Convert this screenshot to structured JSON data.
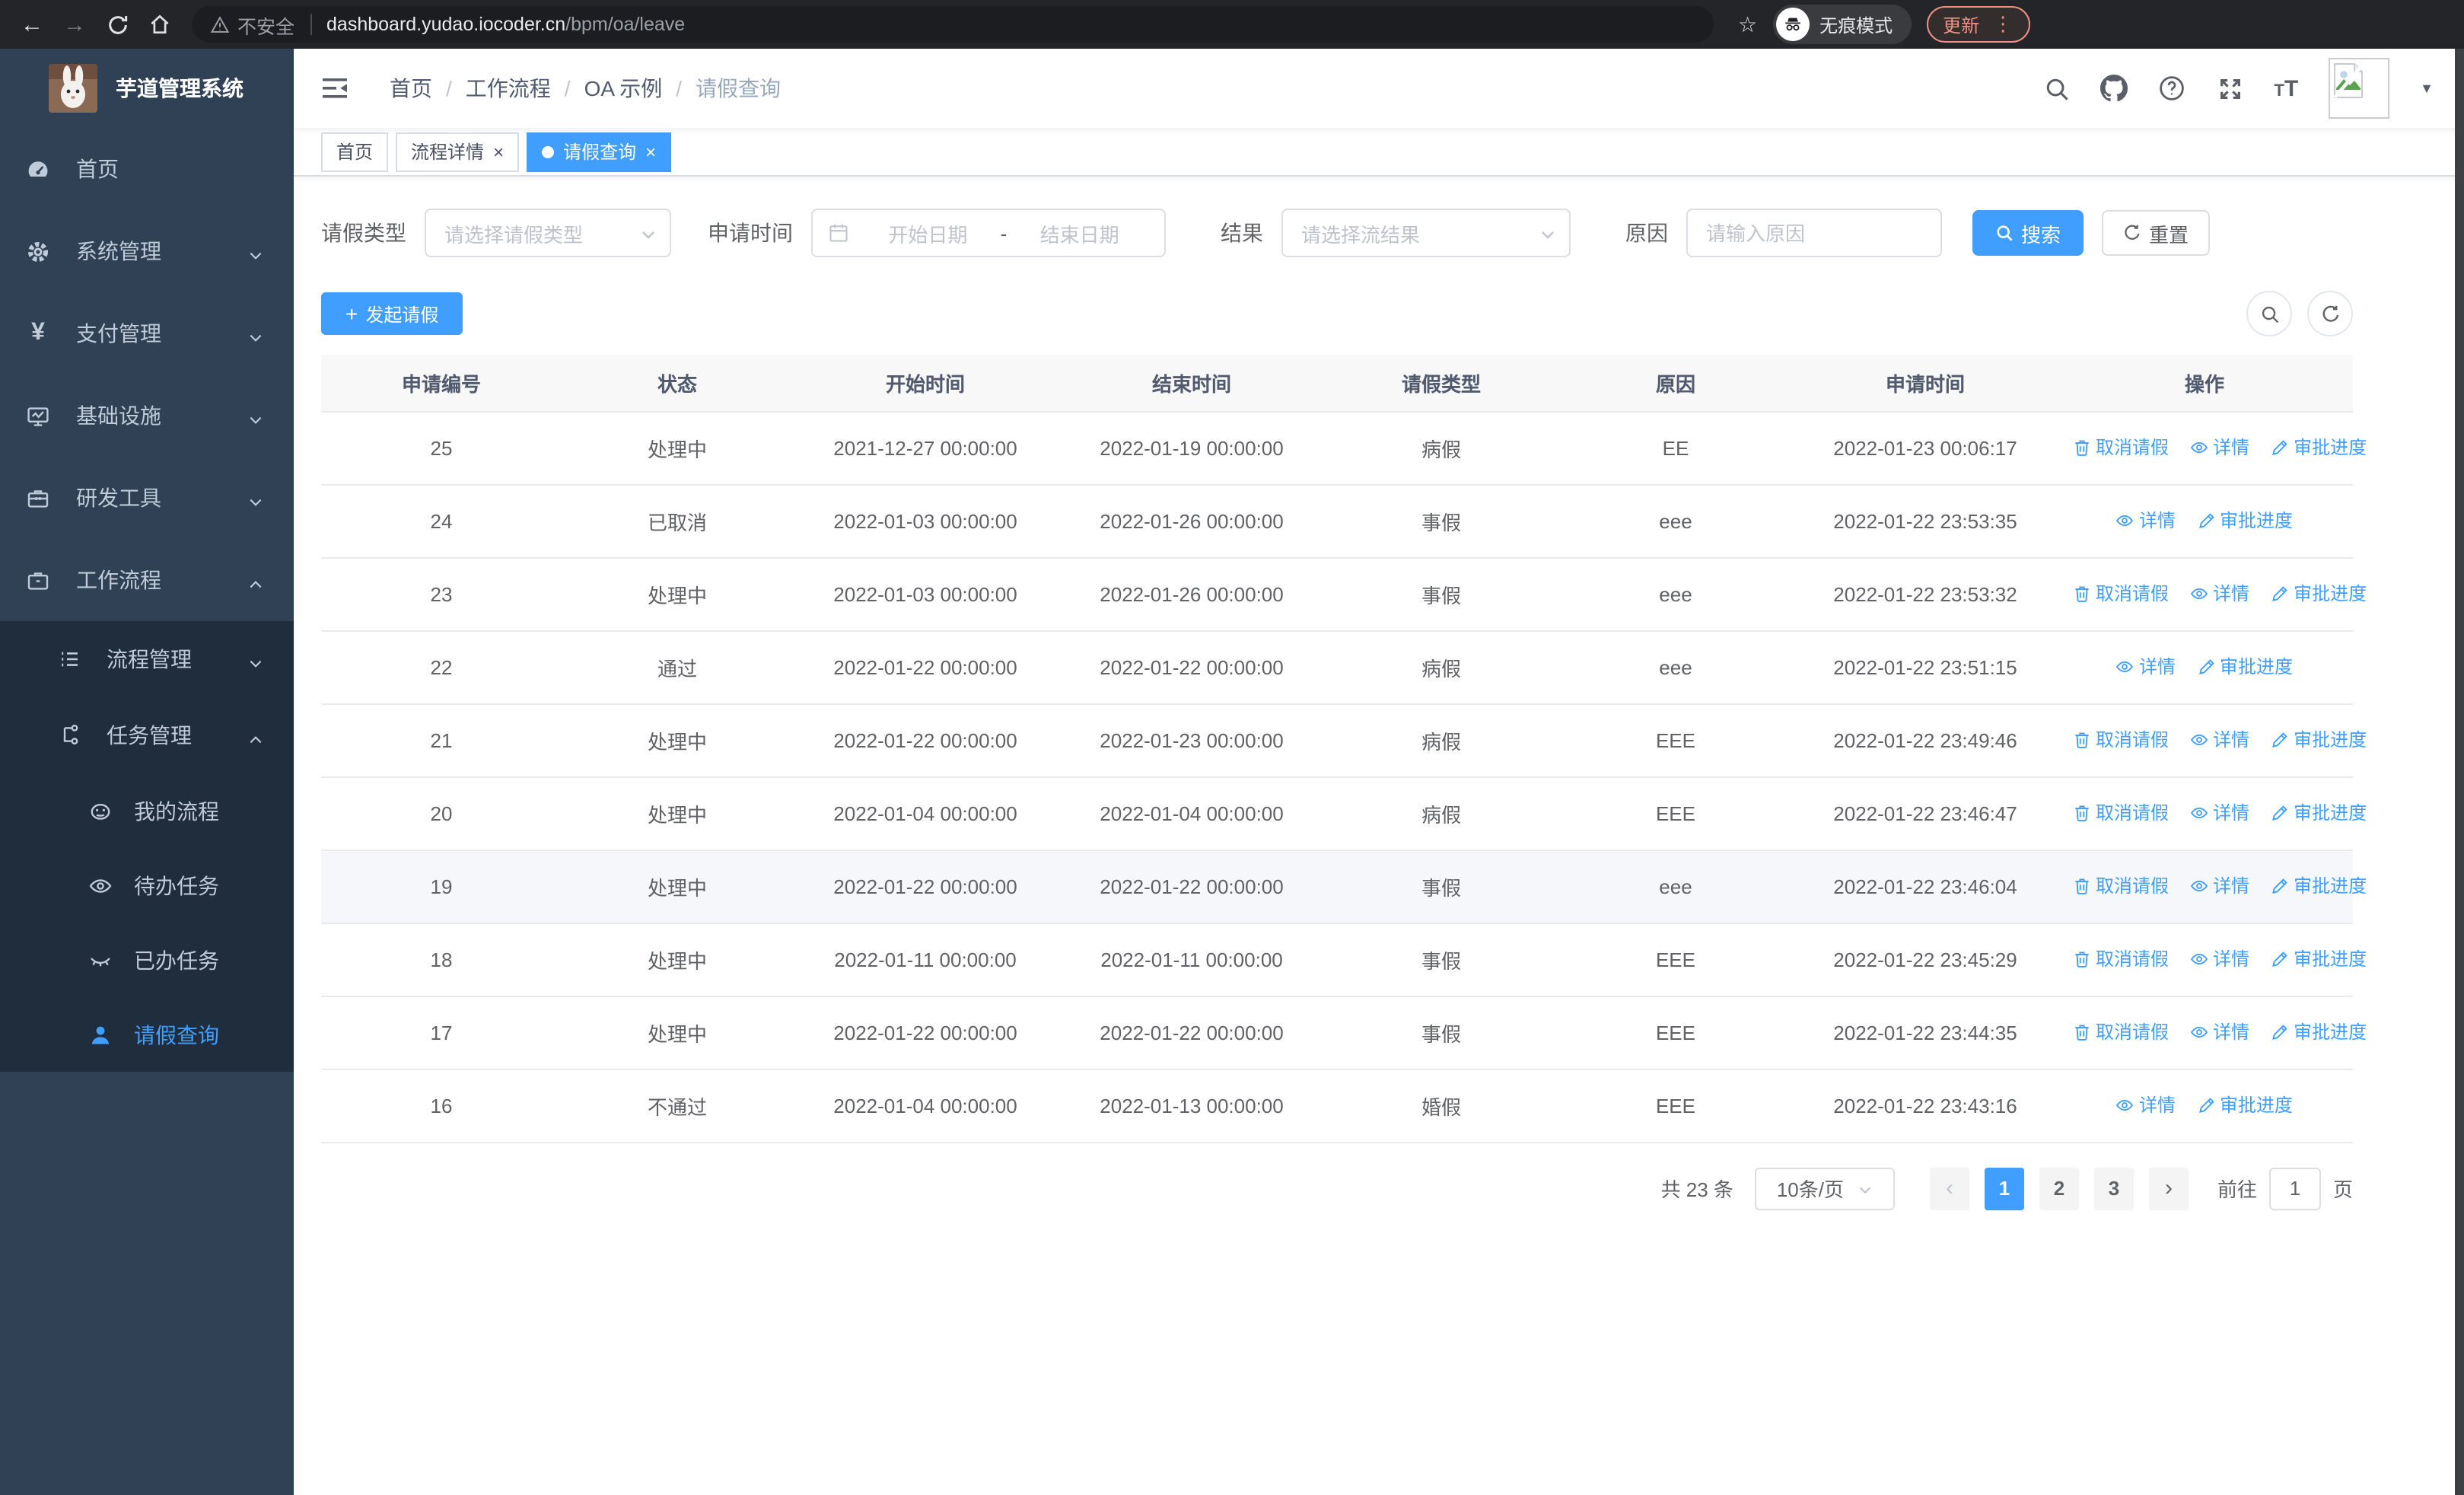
{
  "colors": {
    "primary": "#409eff",
    "link": "#409eff",
    "sidebar_bg": "#304156",
    "submenu_bg": "#1f2d3d",
    "update_accent": "#f08f84"
  },
  "browser": {
    "security_label": "不安全",
    "url_host": "dashboard.yudao.iocoder.cn",
    "url_path": "/bpm/oa/leave",
    "incognito_label": "无痕模式",
    "update_label": "更新"
  },
  "sidebar": {
    "app_title": "芋道管理系统",
    "items": [
      {
        "label": "首页"
      },
      {
        "label": "系统管理"
      },
      {
        "label": "支付管理"
      },
      {
        "label": "基础设施"
      },
      {
        "label": "研发工具"
      },
      {
        "label": "工作流程"
      }
    ],
    "submenu": [
      {
        "label": "流程管理"
      },
      {
        "label": "任务管理"
      }
    ],
    "task_children": [
      {
        "label": "我的流程"
      },
      {
        "label": "待办任务"
      },
      {
        "label": "已办任务"
      },
      {
        "label": "请假查询"
      }
    ]
  },
  "header": {
    "breadcrumb": [
      "首页",
      "工作流程",
      "OA 示例",
      "请假查询"
    ]
  },
  "tabs": {
    "items": [
      {
        "label": "首页"
      },
      {
        "label": "流程详情"
      },
      {
        "label": "请假查询"
      }
    ]
  },
  "filters": {
    "leave_type_label": "请假类型",
    "leave_type_placeholder": "请选择请假类型",
    "apply_time_label": "申请时间",
    "start_date_placeholder": "开始日期",
    "range_separator": "-",
    "end_date_placeholder": "结束日期",
    "result_label": "结果",
    "result_placeholder": "请选择流结果",
    "reason_label": "原因",
    "reason_placeholder": "请输入原因",
    "search_button": "搜索",
    "reset_button": "重置"
  },
  "toolbar": {
    "create_button": "发起请假"
  },
  "table": {
    "columns": [
      "申请编号",
      "状态",
      "开始时间",
      "结束时间",
      "请假类型",
      "原因",
      "申请时间",
      "操作"
    ],
    "action_labels": {
      "cancel": "取消请假",
      "detail": "详情",
      "progress": "审批进度"
    },
    "rows": [
      {
        "id": "25",
        "status": "处理中",
        "start": "2021-12-27 00:00:00",
        "end": "2022-01-19 00:00:00",
        "type": "病假",
        "reason": "EE",
        "applied": "2022-01-23 00:06:17",
        "actions": [
          "cancel",
          "detail",
          "progress"
        ],
        "highlight": false
      },
      {
        "id": "24",
        "status": "已取消",
        "start": "2022-01-03 00:00:00",
        "end": "2022-01-26 00:00:00",
        "type": "事假",
        "reason": "eee",
        "applied": "2022-01-22 23:53:35",
        "actions": [
          "detail",
          "progress"
        ],
        "highlight": false
      },
      {
        "id": "23",
        "status": "处理中",
        "start": "2022-01-03 00:00:00",
        "end": "2022-01-26 00:00:00",
        "type": "事假",
        "reason": "eee",
        "applied": "2022-01-22 23:53:32",
        "actions": [
          "cancel",
          "detail",
          "progress"
        ],
        "highlight": false
      },
      {
        "id": "22",
        "status": "通过",
        "start": "2022-01-22 00:00:00",
        "end": "2022-01-22 00:00:00",
        "type": "病假",
        "reason": "eee",
        "applied": "2022-01-22 23:51:15",
        "actions": [
          "detail",
          "progress"
        ],
        "highlight": false
      },
      {
        "id": "21",
        "status": "处理中",
        "start": "2022-01-22 00:00:00",
        "end": "2022-01-23 00:00:00",
        "type": "病假",
        "reason": "EEE",
        "applied": "2022-01-22 23:49:46",
        "actions": [
          "cancel",
          "detail",
          "progress"
        ],
        "highlight": false
      },
      {
        "id": "20",
        "status": "处理中",
        "start": "2022-01-04 00:00:00",
        "end": "2022-01-04 00:00:00",
        "type": "病假",
        "reason": "EEE",
        "applied": "2022-01-22 23:46:47",
        "actions": [
          "cancel",
          "detail",
          "progress"
        ],
        "highlight": false
      },
      {
        "id": "19",
        "status": "处理中",
        "start": "2022-01-22 00:00:00",
        "end": "2022-01-22 00:00:00",
        "type": "事假",
        "reason": "eee",
        "applied": "2022-01-22 23:46:04",
        "actions": [
          "cancel",
          "detail",
          "progress"
        ],
        "highlight": true
      },
      {
        "id": "18",
        "status": "处理中",
        "start": "2022-01-11 00:00:00",
        "end": "2022-01-11 00:00:00",
        "type": "事假",
        "reason": "EEE",
        "applied": "2022-01-22 23:45:29",
        "actions": [
          "cancel",
          "detail",
          "progress"
        ],
        "highlight": false
      },
      {
        "id": "17",
        "status": "处理中",
        "start": "2022-01-22 00:00:00",
        "end": "2022-01-22 00:00:00",
        "type": "事假",
        "reason": "EEE",
        "applied": "2022-01-22 23:44:35",
        "actions": [
          "cancel",
          "detail",
          "progress"
        ],
        "highlight": false
      },
      {
        "id": "16",
        "status": "不通过",
        "start": "2022-01-04 00:00:00",
        "end": "2022-01-13 00:00:00",
        "type": "婚假",
        "reason": "EEE",
        "applied": "2022-01-22 23:43:16",
        "actions": [
          "detail",
          "progress"
        ],
        "highlight": false
      }
    ]
  },
  "pagination": {
    "total": "共 23 条",
    "page_size": "10条/页",
    "pages": [
      "1",
      "2",
      "3"
    ],
    "active_page": "1",
    "goto_label": "前往",
    "goto_value": "1",
    "unit_label": "页"
  }
}
